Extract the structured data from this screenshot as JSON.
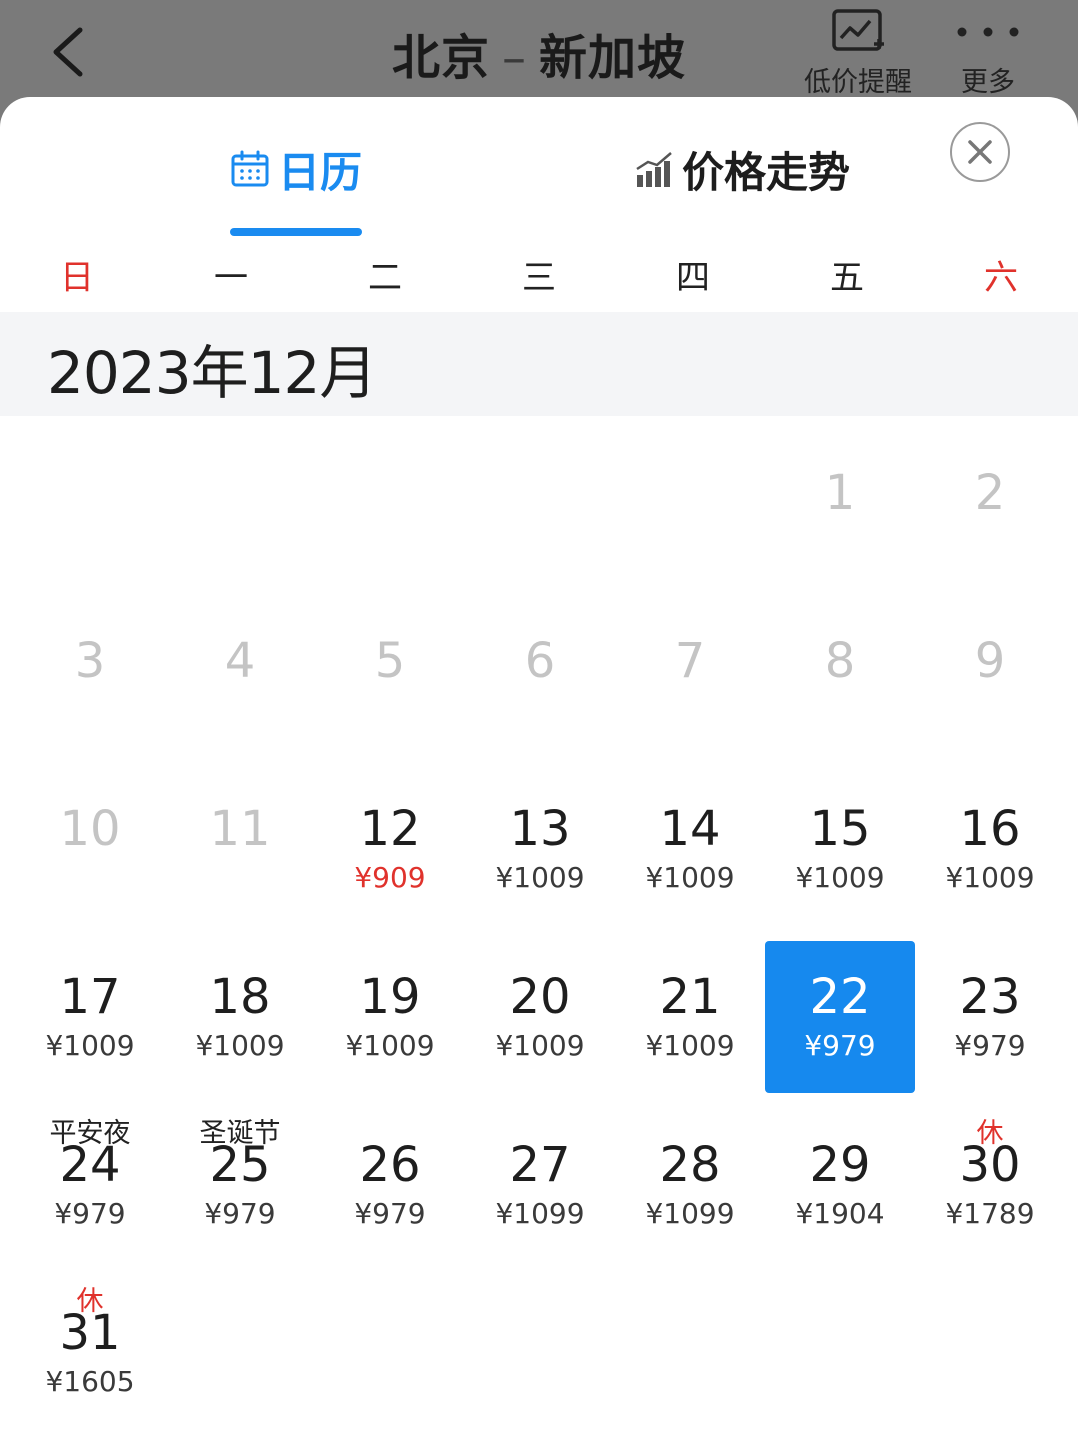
{
  "header": {
    "from_city": "北京",
    "dash": "–",
    "to_city": "新加坡",
    "price_alert_label": "低价提醒",
    "more_label": "更多"
  },
  "tabs": [
    {
      "label": "日历",
      "icon": "calendar-icon",
      "active": true
    },
    {
      "label": "价格走势",
      "icon": "bar-chart-icon",
      "active": false
    }
  ],
  "weekdays": [
    "日",
    "一",
    "二",
    "三",
    "四",
    "五",
    "六"
  ],
  "month_title": "2023年12月",
  "colors": {
    "accent": "#1a8bf0",
    "selected_bg": "#1689ee",
    "holiday_red": "#e0322c",
    "past_gray": "#c4c4c4"
  },
  "days": [
    {
      "d": "1",
      "price": "",
      "status": "past"
    },
    {
      "d": "2",
      "price": "",
      "status": "past"
    },
    {
      "d": "3",
      "price": "",
      "status": "past"
    },
    {
      "d": "4",
      "price": "",
      "status": "past"
    },
    {
      "d": "5",
      "price": "",
      "status": "past"
    },
    {
      "d": "6",
      "price": "",
      "status": "past"
    },
    {
      "d": "7",
      "price": "",
      "status": "past"
    },
    {
      "d": "8",
      "price": "",
      "status": "past"
    },
    {
      "d": "9",
      "price": "",
      "status": "past"
    },
    {
      "d": "10",
      "price": "",
      "status": "past"
    },
    {
      "d": "11",
      "price": "",
      "status": "past"
    },
    {
      "d": "12",
      "price": "¥909",
      "status": "low"
    },
    {
      "d": "13",
      "price": "¥1009",
      "status": "normal"
    },
    {
      "d": "14",
      "price": "¥1009",
      "status": "normal"
    },
    {
      "d": "15",
      "price": "¥1009",
      "status": "normal"
    },
    {
      "d": "16",
      "price": "¥1009",
      "status": "normal"
    },
    {
      "d": "17",
      "price": "¥1009",
      "status": "normal"
    },
    {
      "d": "18",
      "price": "¥1009",
      "status": "normal"
    },
    {
      "d": "19",
      "price": "¥1009",
      "status": "normal"
    },
    {
      "d": "20",
      "price": "¥1009",
      "status": "normal"
    },
    {
      "d": "21",
      "price": "¥1009",
      "status": "normal"
    },
    {
      "d": "22",
      "price": "¥979",
      "status": "selected"
    },
    {
      "d": "23",
      "price": "¥979",
      "status": "normal"
    },
    {
      "d": "24",
      "price": "¥979",
      "status": "normal",
      "holiday": "平安夜"
    },
    {
      "d": "25",
      "price": "¥979",
      "status": "normal",
      "holiday": "圣诞节"
    },
    {
      "d": "26",
      "price": "¥979",
      "status": "normal"
    },
    {
      "d": "27",
      "price": "¥1099",
      "status": "normal"
    },
    {
      "d": "28",
      "price": "¥1099",
      "status": "normal"
    },
    {
      "d": "29",
      "price": "¥1904",
      "status": "normal"
    },
    {
      "d": "30",
      "price": "¥1789",
      "status": "normal",
      "holiday": "休",
      "holiday_rest": true
    },
    {
      "d": "31",
      "price": "¥1605",
      "status": "normal",
      "holiday": "休",
      "holiday_rest": true
    }
  ]
}
